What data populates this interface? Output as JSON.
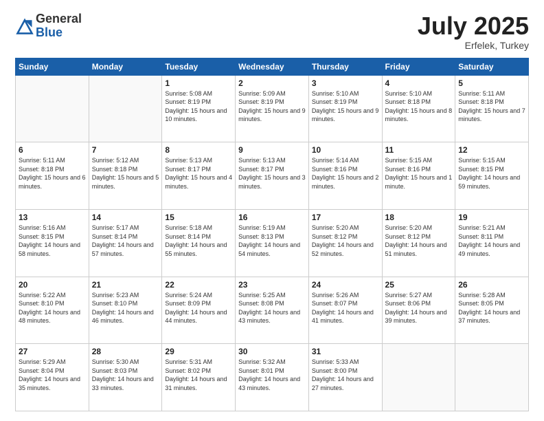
{
  "header": {
    "logo_general": "General",
    "logo_blue": "Blue",
    "month_title": "July 2025",
    "location": "Erfelek, Turkey"
  },
  "weekdays": [
    "Sunday",
    "Monday",
    "Tuesday",
    "Wednesday",
    "Thursday",
    "Friday",
    "Saturday"
  ],
  "weeks": [
    [
      {
        "day": "",
        "sunrise": "",
        "sunset": "",
        "daylight": ""
      },
      {
        "day": "",
        "sunrise": "",
        "sunset": "",
        "daylight": ""
      },
      {
        "day": "1",
        "sunrise": "Sunrise: 5:08 AM",
        "sunset": "Sunset: 8:19 PM",
        "daylight": "Daylight: 15 hours and 10 minutes."
      },
      {
        "day": "2",
        "sunrise": "Sunrise: 5:09 AM",
        "sunset": "Sunset: 8:19 PM",
        "daylight": "Daylight: 15 hours and 9 minutes."
      },
      {
        "day": "3",
        "sunrise": "Sunrise: 5:10 AM",
        "sunset": "Sunset: 8:19 PM",
        "daylight": "Daylight: 15 hours and 9 minutes."
      },
      {
        "day": "4",
        "sunrise": "Sunrise: 5:10 AM",
        "sunset": "Sunset: 8:18 PM",
        "daylight": "Daylight: 15 hours and 8 minutes."
      },
      {
        "day": "5",
        "sunrise": "Sunrise: 5:11 AM",
        "sunset": "Sunset: 8:18 PM",
        "daylight": "Daylight: 15 hours and 7 minutes."
      }
    ],
    [
      {
        "day": "6",
        "sunrise": "Sunrise: 5:11 AM",
        "sunset": "Sunset: 8:18 PM",
        "daylight": "Daylight: 15 hours and 6 minutes."
      },
      {
        "day": "7",
        "sunrise": "Sunrise: 5:12 AM",
        "sunset": "Sunset: 8:18 PM",
        "daylight": "Daylight: 15 hours and 5 minutes."
      },
      {
        "day": "8",
        "sunrise": "Sunrise: 5:13 AM",
        "sunset": "Sunset: 8:17 PM",
        "daylight": "Daylight: 15 hours and 4 minutes."
      },
      {
        "day": "9",
        "sunrise": "Sunrise: 5:13 AM",
        "sunset": "Sunset: 8:17 PM",
        "daylight": "Daylight: 15 hours and 3 minutes."
      },
      {
        "day": "10",
        "sunrise": "Sunrise: 5:14 AM",
        "sunset": "Sunset: 8:16 PM",
        "daylight": "Daylight: 15 hours and 2 minutes."
      },
      {
        "day": "11",
        "sunrise": "Sunrise: 5:15 AM",
        "sunset": "Sunset: 8:16 PM",
        "daylight": "Daylight: 15 hours and 1 minute."
      },
      {
        "day": "12",
        "sunrise": "Sunrise: 5:15 AM",
        "sunset": "Sunset: 8:15 PM",
        "daylight": "Daylight: 14 hours and 59 minutes."
      }
    ],
    [
      {
        "day": "13",
        "sunrise": "Sunrise: 5:16 AM",
        "sunset": "Sunset: 8:15 PM",
        "daylight": "Daylight: 14 hours and 58 minutes."
      },
      {
        "day": "14",
        "sunrise": "Sunrise: 5:17 AM",
        "sunset": "Sunset: 8:14 PM",
        "daylight": "Daylight: 14 hours and 57 minutes."
      },
      {
        "day": "15",
        "sunrise": "Sunrise: 5:18 AM",
        "sunset": "Sunset: 8:14 PM",
        "daylight": "Daylight: 14 hours and 55 minutes."
      },
      {
        "day": "16",
        "sunrise": "Sunrise: 5:19 AM",
        "sunset": "Sunset: 8:13 PM",
        "daylight": "Daylight: 14 hours and 54 minutes."
      },
      {
        "day": "17",
        "sunrise": "Sunrise: 5:20 AM",
        "sunset": "Sunset: 8:12 PM",
        "daylight": "Daylight: 14 hours and 52 minutes."
      },
      {
        "day": "18",
        "sunrise": "Sunrise: 5:20 AM",
        "sunset": "Sunset: 8:12 PM",
        "daylight": "Daylight: 14 hours and 51 minutes."
      },
      {
        "day": "19",
        "sunrise": "Sunrise: 5:21 AM",
        "sunset": "Sunset: 8:11 PM",
        "daylight": "Daylight: 14 hours and 49 minutes."
      }
    ],
    [
      {
        "day": "20",
        "sunrise": "Sunrise: 5:22 AM",
        "sunset": "Sunset: 8:10 PM",
        "daylight": "Daylight: 14 hours and 48 minutes."
      },
      {
        "day": "21",
        "sunrise": "Sunrise: 5:23 AM",
        "sunset": "Sunset: 8:10 PM",
        "daylight": "Daylight: 14 hours and 46 minutes."
      },
      {
        "day": "22",
        "sunrise": "Sunrise: 5:24 AM",
        "sunset": "Sunset: 8:09 PM",
        "daylight": "Daylight: 14 hours and 44 minutes."
      },
      {
        "day": "23",
        "sunrise": "Sunrise: 5:25 AM",
        "sunset": "Sunset: 8:08 PM",
        "daylight": "Daylight: 14 hours and 43 minutes."
      },
      {
        "day": "24",
        "sunrise": "Sunrise: 5:26 AM",
        "sunset": "Sunset: 8:07 PM",
        "daylight": "Daylight: 14 hours and 41 minutes."
      },
      {
        "day": "25",
        "sunrise": "Sunrise: 5:27 AM",
        "sunset": "Sunset: 8:06 PM",
        "daylight": "Daylight: 14 hours and 39 minutes."
      },
      {
        "day": "26",
        "sunrise": "Sunrise: 5:28 AM",
        "sunset": "Sunset: 8:05 PM",
        "daylight": "Daylight: 14 hours and 37 minutes."
      }
    ],
    [
      {
        "day": "27",
        "sunrise": "Sunrise: 5:29 AM",
        "sunset": "Sunset: 8:04 PM",
        "daylight": "Daylight: 14 hours and 35 minutes."
      },
      {
        "day": "28",
        "sunrise": "Sunrise: 5:30 AM",
        "sunset": "Sunset: 8:03 PM",
        "daylight": "Daylight: 14 hours and 33 minutes."
      },
      {
        "day": "29",
        "sunrise": "Sunrise: 5:31 AM",
        "sunset": "Sunset: 8:02 PM",
        "daylight": "Daylight: 14 hours and 31 minutes."
      },
      {
        "day": "30",
        "sunrise": "Sunrise: 5:32 AM",
        "sunset": "Sunset: 8:01 PM",
        "daylight": "Daylight: 14 hours and 43 minutes."
      },
      {
        "day": "31",
        "sunrise": "Sunrise: 5:33 AM",
        "sunset": "Sunset: 8:00 PM",
        "daylight": "Daylight: 14 hours and 27 minutes."
      },
      {
        "day": "",
        "sunrise": "",
        "sunset": "",
        "daylight": ""
      },
      {
        "day": "",
        "sunrise": "",
        "sunset": "",
        "daylight": ""
      }
    ]
  ]
}
